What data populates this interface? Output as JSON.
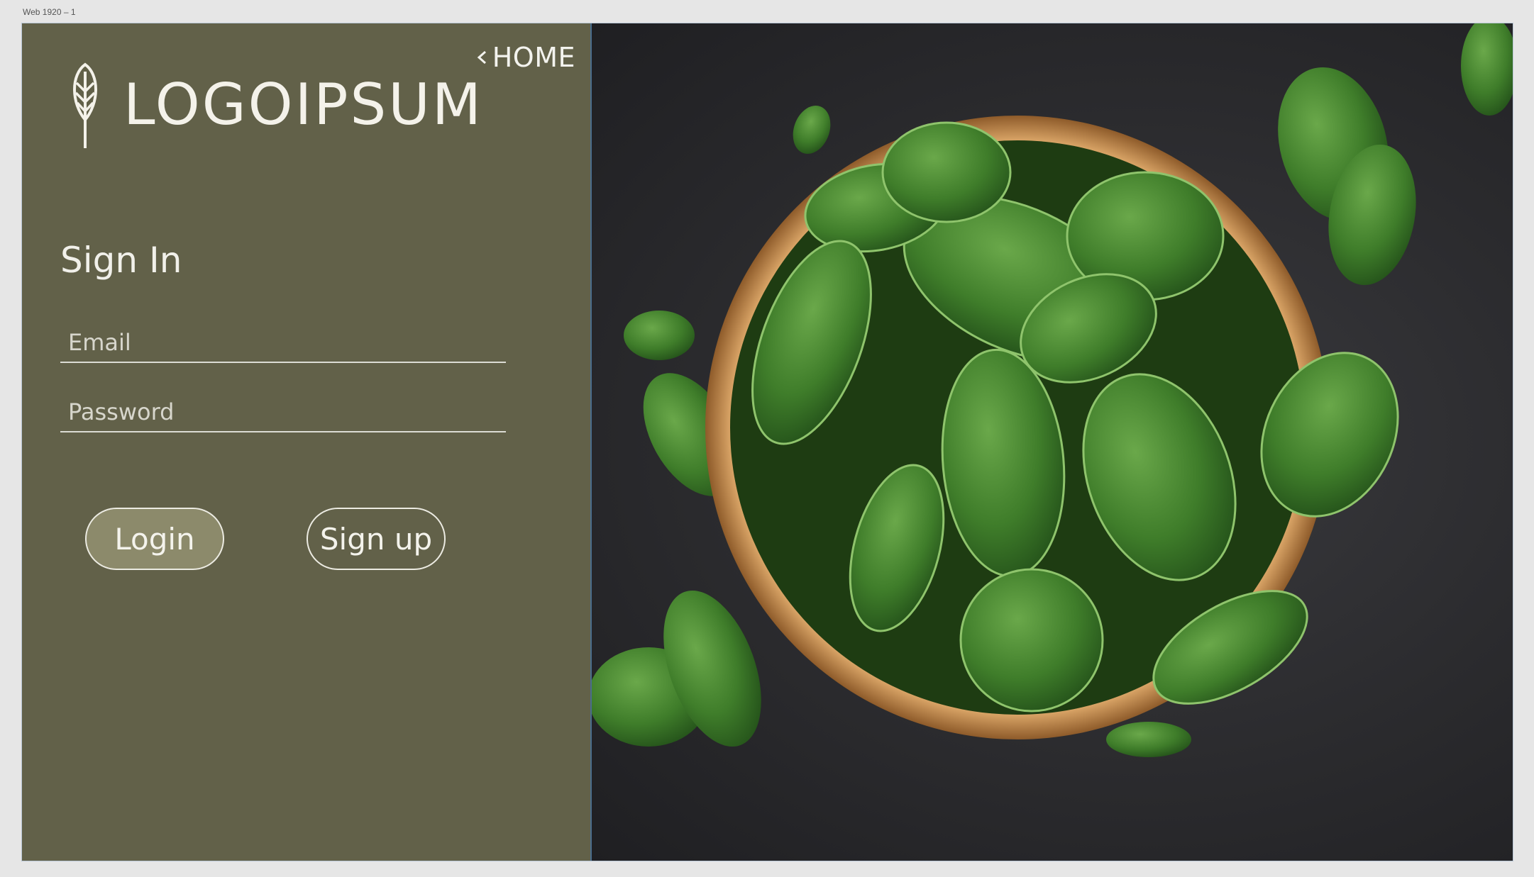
{
  "artboard": {
    "label": "Web 1920 – 1"
  },
  "nav": {
    "home_label": "HOME"
  },
  "brand": {
    "name": "LOGOIPSUM"
  },
  "form": {
    "title": "Sign In",
    "email_placeholder": "Email",
    "password_placeholder": "Password"
  },
  "actions": {
    "login_label": "Login",
    "signup_label": "Sign up"
  },
  "icons": {
    "home_chevron": "chevron-left-icon",
    "logo_mark": "wheat-leaf-icon"
  },
  "colors": {
    "panel": "#626149",
    "login_button": "#8c8a6b",
    "text": "#f1f0ea",
    "canvas": "#e6e6e6"
  }
}
